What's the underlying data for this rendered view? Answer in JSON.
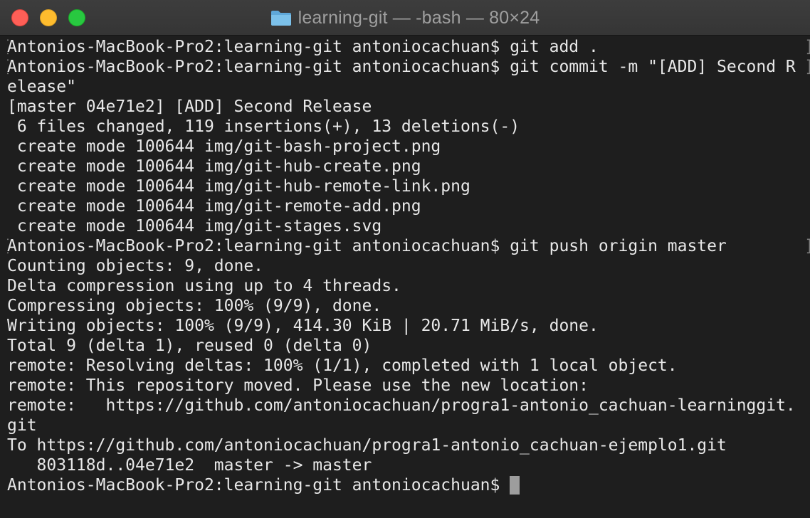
{
  "window": {
    "title": "learning-git — -bash — 80×24",
    "title_icon": "folder-icon"
  },
  "colors": {
    "background": "#1e1e1e",
    "text": "#e8e8e8",
    "titlebar": "#383838",
    "close": "#fe5f57",
    "minimize": "#febc2e",
    "zoom": "#28c840",
    "cursor": "#9d9d9d"
  },
  "terminal": {
    "lines": [
      "Antonios-MacBook-Pro2:learning-git antoniocachuan$ git add .",
      "Antonios-MacBook-Pro2:learning-git antoniocachuan$ git commit -m \"[ADD] Second R",
      "elease\"",
      "[master 04e71e2] [ADD] Second Release",
      " 6 files changed, 119 insertions(+), 13 deletions(-)",
      " create mode 100644 img/git-bash-project.png",
      " create mode 100644 img/git-hub-create.png",
      " create mode 100644 img/git-hub-remote-link.png",
      " create mode 100644 img/git-remote-add.png",
      " create mode 100644 img/git-stages.svg",
      "Antonios-MacBook-Pro2:learning-git antoniocachuan$ git push origin master",
      "Counting objects: 9, done.",
      "Delta compression using up to 4 threads.",
      "Compressing objects: 100% (9/9), done.",
      "Writing objects: 100% (9/9), 414.30 KiB | 20.71 MiB/s, done.",
      "Total 9 (delta 1), reused 0 (delta 0)",
      "remote: Resolving deltas: 100% (1/1), completed with 1 local object.",
      "remote: This repository moved. Please use the new location:",
      "remote:   https://github.com/antoniocachuan/progra1-antonio_cachuan-learninggit.",
      "git",
      "To https://github.com/antoniocachuan/progra1-antonio_cachuan-ejemplo1.git",
      "   803118d..04e71e2  master -> master",
      "Antonios-MacBook-Pro2:learning-git antoniocachuan$ "
    ],
    "left_marker": "[",
    "right_marker": "]"
  }
}
